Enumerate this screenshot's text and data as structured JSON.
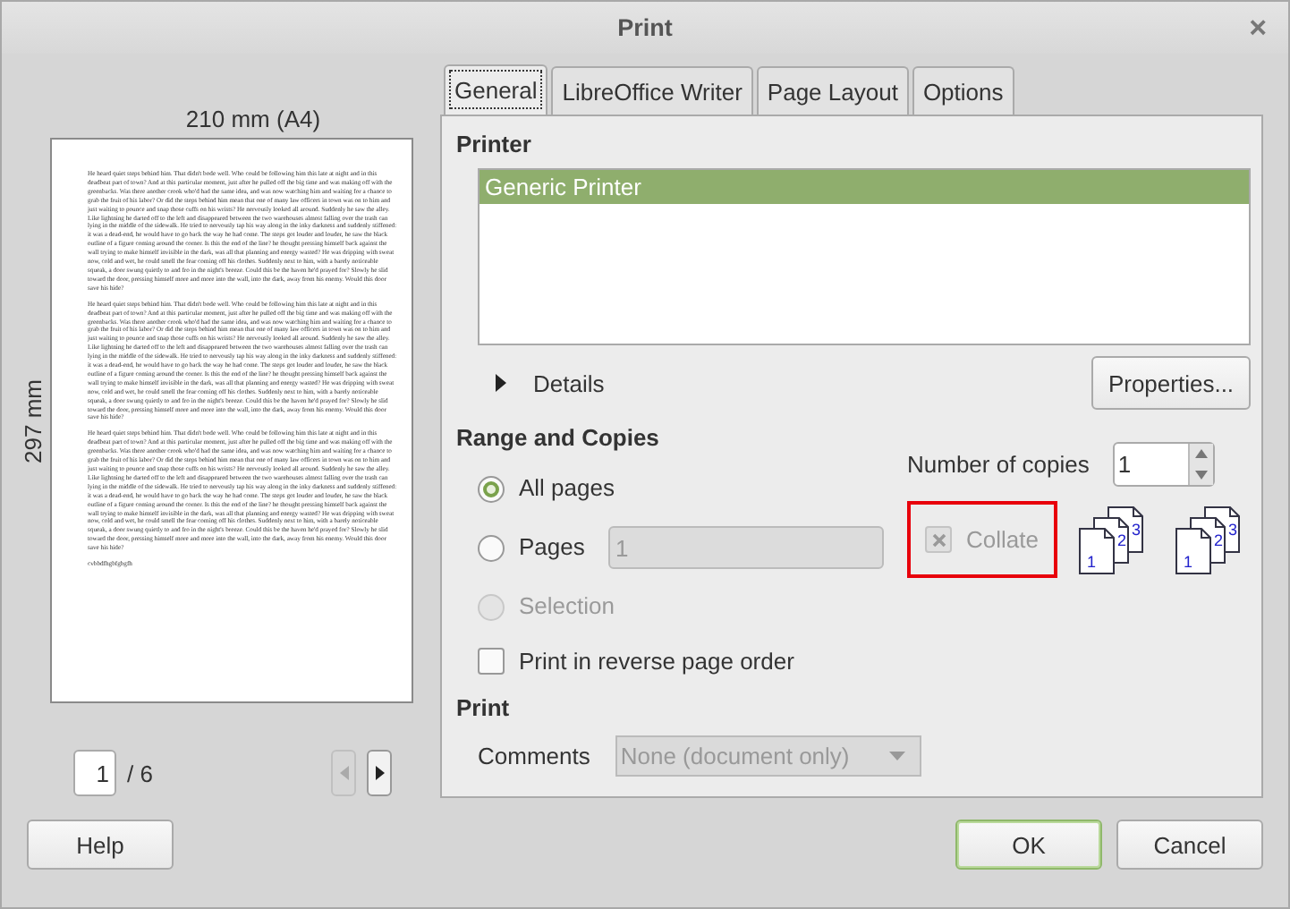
{
  "window": {
    "title": "Print",
    "close": "×"
  },
  "preview": {
    "width_label": "210 mm (A4)",
    "height_label": "297 mm",
    "paragraphs": [
      "He heard quiet steps behind him. That didn't bode well. Who could be following him this late at night and in this deadbeat part of town? And at this particular moment, just after he pulled off the big time and was making off with the greenbacks. Was there another crook who'd had the same idea, and was now watching him and waiting for a chance to grab the fruit of his labor? Or did the steps behind him mean that one of many law officers in town was on to him and just waiting to pounce and snap those cuffs on his wrists? He nervously looked all around. Suddenly he saw the alley. Like lightning he darted off to the left and disappeared between the two warehouses almost falling over the trash can lying in the middle of the sidewalk. He tried to nervously tap his way along in the inky darkness and suddenly stiffened: it was a dead-end, he would have to go back the way he had come. The steps got louder and louder, he saw the black outline of a figure coming around the corner. Is this the end of the line? he thought pressing himself back against the wall trying to make himself invisible in the dark, was all that planning and energy wasted? He was dripping with sweat now, cold and wet, he could smell the fear coming off his clothes. Suddenly next to him, with a barely noticeable squeak, a door swung quietly to and fro in the night's breeze. Could this be the haven he'd prayed for? Slowly he slid toward the door, pressing himself more and more into the wall, into the dark, away from his enemy. Would this door save his hide?",
      "He heard quiet steps behind him. That didn't bode well. Who could be following him this late at night and in this deadbeat part of town? And at this particular moment, just after he pulled off the big time and was making off with the greenbacks. Was there another crook who'd had the same idea, and was now watching him and waiting for a chance to grab the fruit of his labor? Or did the steps behind him mean that one of many law officers in town was on to him and just waiting to pounce and snap those cuffs on his wrists? He nervously looked all around. Suddenly he saw the alley. Like lightning he darted off to the left and disappeared between the two warehouses almost falling over the trash can lying in the middle of the sidewalk. He tried to nervously tap his way along in the inky darkness and suddenly stiffened: it was a dead-end, he would have to go back the way he had come. The steps got louder and louder, he saw the black outline of a figure coming around the corner. Is this the end of the line? he thought pressing himself back against the wall trying to make himself invisible in the dark, was all that planning and energy wasted? He was dripping with sweat now, cold and wet, he could smell the fear coming off his clothes. Suddenly next to him, with a barely noticeable squeak, a door swung quietly to and fro in the night's breeze. Could this be the haven he'd prayed for? Slowly he slid toward the door, pressing himself more and more into the wall, into the dark, away from his enemy. Would this door save his hide?",
      "He heard quiet steps behind him. That didn't bode well. Who could be following him this late at night and in this deadbeat part of town? And at this particular moment, just after he pulled off the big time and was making off with the greenbacks. Was there another crook who'd had the same idea, and was now watching him and waiting for a chance to grab the fruit of his labor? Or did the steps behind him mean that one of many law officers in town was on to him and just waiting to pounce and snap those cuffs on his wrists? He nervously looked all around. Suddenly he saw the alley. Like lightning he darted off to the left and disappeared between the two warehouses almost falling over the trash can lying in the middle of the sidewalk. He tried to nervously tap his way along in the inky darkness and suddenly stiffened: it was a dead-end, he would have to go back the way he had come. The steps got louder and louder, he saw the black outline of a figure coming around the corner. Is this the end of the line? he thought pressing himself back against the wall trying to make himself invisible in the dark, was all that planning and energy wasted? He was dripping with sweat now, cold and wet, he could smell the fear coming off his clothes. Suddenly next to him, with a barely noticeable squeak, a door swung quietly to and fro in the night's breeze. Could this be the haven he'd prayed for? Slowly he slid toward the door, pressing himself more and more into the wall, into the dark, away from his enemy. Would this door save his hide?",
      "cvbbdfhgbfgbgfh"
    ],
    "page": "1",
    "page_total": "/ 6",
    "prev_disabled": true,
    "next_disabled": false
  },
  "tabs": [
    {
      "label": "General",
      "selected": true
    },
    {
      "label": "LibreOffice Writer",
      "selected": false
    },
    {
      "label": "Page Layout",
      "selected": false
    },
    {
      "label": "Options",
      "selected": false
    }
  ],
  "printer": {
    "heading": "Printer",
    "printers": [
      {
        "name": "Generic Printer",
        "selected": true
      }
    ],
    "details": {
      "label": "Details",
      "expanded": false
    },
    "properties_button": "Properties..."
  },
  "range": {
    "heading": "Range and Copies",
    "options": [
      {
        "label": "All pages",
        "selected": true,
        "disabled": false,
        "kind": "plain"
      },
      {
        "label": "Pages",
        "selected": false,
        "disabled": false,
        "kind": "with-field",
        "value": "1"
      },
      {
        "label": "Selection",
        "selected": false,
        "disabled": true,
        "kind": "plain"
      }
    ],
    "copies_label": "Number of copies",
    "copies": "1",
    "collate": {
      "label": "Collate",
      "checked": true,
      "disabled": true,
      "highlighted": true
    },
    "collate_icons": [
      {
        "pages": [
          "1",
          "2",
          "3"
        ]
      },
      {
        "pages": [
          "1",
          "2",
          "3"
        ]
      }
    ],
    "reverse": {
      "label": "Print in reverse page order",
      "checked": false
    }
  },
  "print": {
    "heading": "Print",
    "comments_label": "Comments",
    "comments_value": "None (document only)",
    "comments_disabled": true
  },
  "footer": {
    "left": [
      {
        "label": "Help",
        "default": false
      }
    ],
    "right": [
      {
        "label": "OK",
        "default": true
      },
      {
        "label": "Cancel",
        "default": false
      }
    ]
  }
}
